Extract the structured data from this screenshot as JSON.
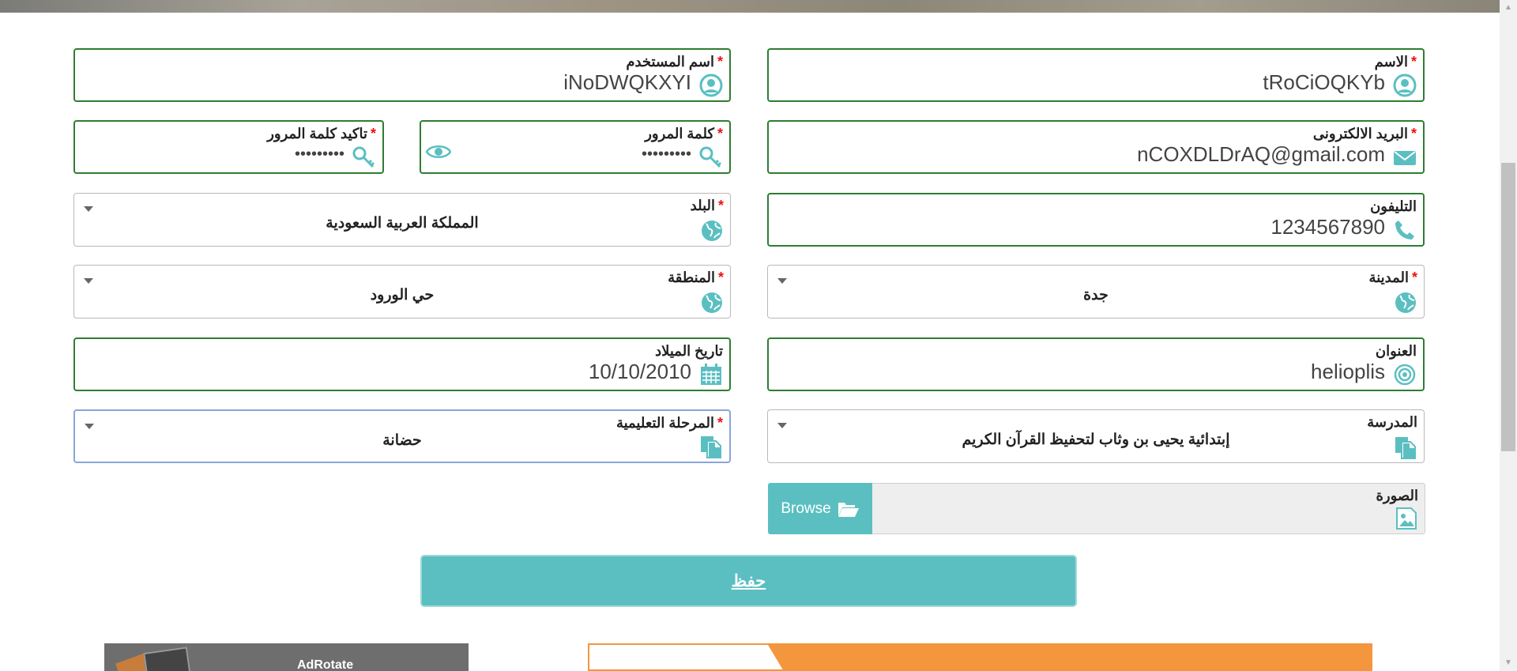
{
  "form": {
    "name": {
      "label": "الاسم",
      "required": "*",
      "value": "tRoCiOQKYb"
    },
    "username": {
      "label": "اسم المستخدم",
      "required": "*",
      "value": "iNoDWQKXYI"
    },
    "email": {
      "label": "البريد الالكترونى",
      "required": "*",
      "value": "nCOXDLDrAQ@gmail.com"
    },
    "password": {
      "label": "كلمة المرور",
      "required": "*",
      "value": "•••••••••"
    },
    "confirm_password": {
      "label": "تاكيد كلمة المرور",
      "required": "*",
      "value": "•••••••••"
    },
    "phone": {
      "label": "التليفون",
      "value": "1234567890"
    },
    "country": {
      "label": "البلد",
      "required": "*",
      "value": "المملكة العربية السعودية"
    },
    "city": {
      "label": "المدينة",
      "required": "*",
      "value": "جدة"
    },
    "region": {
      "label": "المنطقة",
      "required": "*",
      "value": "حي الورود"
    },
    "address": {
      "label": "العنوان",
      "value": "helioplis"
    },
    "birthdate": {
      "label": "تاريخ الميلاد",
      "value": "10/10/2010"
    },
    "school": {
      "label": "المدرسة",
      "value": "إبتدائية يحيى بن وثاب لتحفيظ القرآن الكريم"
    },
    "stage": {
      "label": "المرحلة التعليمية",
      "required": "*",
      "value": "حضانة"
    },
    "image": {
      "label": "الصورة",
      "browse_label": "Browse"
    },
    "save_label": "حفظ"
  },
  "ads": {
    "left_text": "AdRotate"
  },
  "colors": {
    "field_border": "#2f7d32",
    "accent": "#5bbfc1",
    "icon": "#5bbfc1",
    "required": "#ee1111",
    "ad_orange": "#f3963e"
  },
  "icons": {
    "name": "user-circle-icon",
    "username": "user-circle-icon",
    "email": "envelope-icon",
    "password": "key-icon",
    "confirm_password": "key-icon",
    "phone": "phone-icon",
    "country": "globe-icon",
    "city": "globe-icon",
    "region": "globe-icon",
    "address": "target-icon",
    "birthdate": "calendar-icon",
    "school": "documents-icon",
    "stage": "documents-icon",
    "image": "image-icon",
    "browse": "folder-open-icon",
    "show_password": "eye-icon"
  }
}
